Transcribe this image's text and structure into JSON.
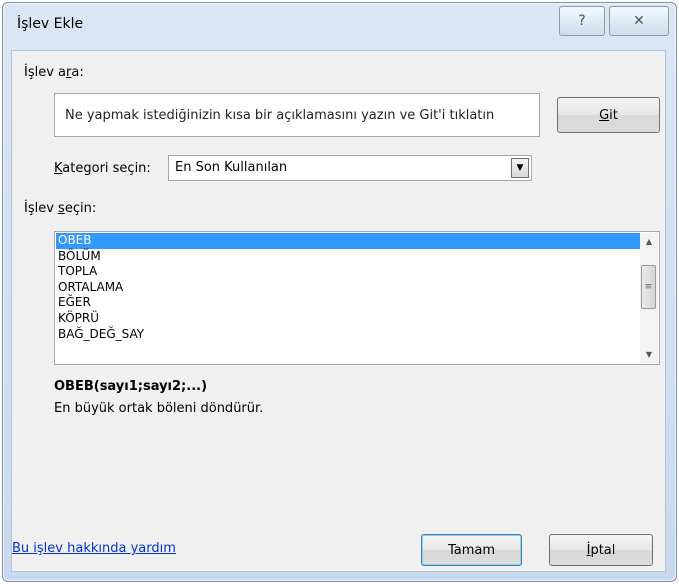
{
  "window": {
    "title": "İşlev Ekle",
    "help_glyph": "?",
    "close_glyph": "✕"
  },
  "search": {
    "label_pre": "İşlev a",
    "label_ul": "r",
    "label_post": "a:",
    "value": "Ne yapmak istediğinizin kısa bir açıklamasını yazın ve Git'i tıklatın",
    "go_ul": "G",
    "go_post": "it"
  },
  "category": {
    "label_ul": "K",
    "label_post": "ategori seçin:",
    "selected": "En Son Kullanılan"
  },
  "functions": {
    "label_pre": "İşlev ",
    "label_ul": "s",
    "label_post": "eçin:",
    "items": [
      "OBEB",
      "BÖLÜM",
      "TOPLA",
      "ORTALAMA",
      "EĞER",
      "KÖPRÜ",
      "BAĞ_DEĞ_SAY"
    ],
    "selected_index": 0
  },
  "selected_function": {
    "signature": "OBEB(sayı1;sayı2;...)",
    "description": "En büyük ortak böleni döndürür."
  },
  "footer": {
    "help_link": "Bu işlev hakkında yardım",
    "ok": "Tamam",
    "cancel_ul": "İ",
    "cancel_post": "ptal"
  },
  "icons": {
    "dropdown": "chevron-down-icon",
    "scroll_up": "scroll-up-icon",
    "scroll_down": "scroll-down-icon"
  }
}
